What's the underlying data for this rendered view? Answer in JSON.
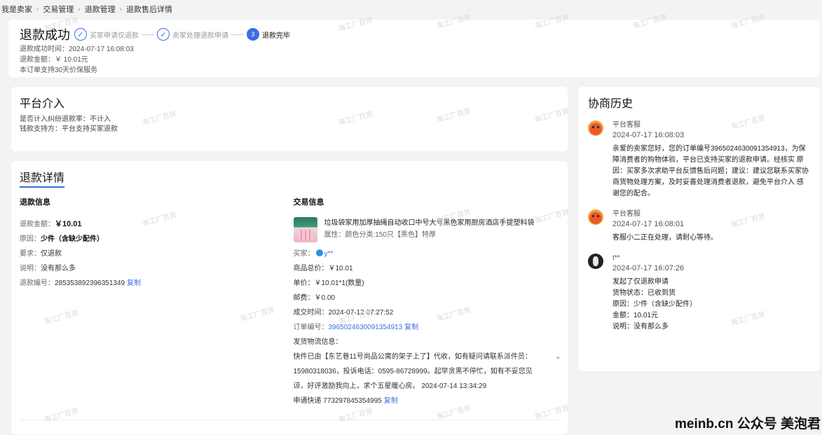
{
  "breadcrumb": [
    "我是卖家",
    "交易管理",
    "退款管理",
    "退款售后详情"
  ],
  "status": {
    "title": "退款成功",
    "steps": [
      {
        "label": "买家申请仅退款",
        "marker": "✓"
      },
      {
        "label": "卖家处理退款申请",
        "marker": "✓"
      },
      {
        "label": "退款完毕",
        "marker": "3"
      }
    ],
    "success_time": "退款成功时间：2024-07-17 16:08:03",
    "amount": "退款金额：￥ 10.01元",
    "guarantee": "本订单支持30天价保服务"
  },
  "platform": {
    "title": "平台介入",
    "dispute_rate": "是否计入纠纷退款率：不计入",
    "payment_support": "钱款支持方：平台支持买家退款"
  },
  "refund_detail": {
    "title": "退款详情",
    "refund_info": {
      "title": "退款信息",
      "amount_key": "退款金额：",
      "amount_value": "￥10.01",
      "reason_key": "原因：",
      "reason_value": "少件（含缺少配件）",
      "request_key": "要求：",
      "request_value": "仅退款",
      "note_key": "说明：",
      "note_value": "没有那么多",
      "number_key": "退款编号：",
      "number_value": "285353892396351349",
      "copy": "复制"
    },
    "trade_info": {
      "title": "交易信息",
      "product_name": "垃圾袋家用加厚抽绳自动收口中号大号黑色家用厨房酒店手提塑料袋",
      "product_attr": "属性：颜色分类:150只【黑色】特厚",
      "buyer_key": "买家：",
      "buyer_value": "y**",
      "total_price": "商品总价：￥10.01",
      "unit_price": "单价：￥10.01*1(数量)",
      "postage": "邮费：￥0.00",
      "trade_time": "成交时间：2024-07-12 07:27:52",
      "order_key": "订单编号：",
      "order_value": "3965024630091354913",
      "copy": "复制",
      "logistics_label": "发货物流信息：",
      "logistics_text": "快件已由【东艺巷11号尚品公寓的架子上了】代收，如有疑问请联系派件员：15980318036，投诉电话：0595-86728999。起早贪黑不停忙，如有不妥您见谅，好评激励我向上，求个五星暖心房。 2024-07-14 13:34:29",
      "tracking": "申通快递 773297845354995",
      "copy2": "复制"
    }
  },
  "history": {
    "title": "协商历史",
    "items": [
      {
        "name": "平台客服",
        "time": "2024-07-17 16:08:03",
        "content": "亲爱的卖家您好，您的订单编号3965024630091354913，为保障消费者的购物体验，平台已支持买家的退款申请。经核实 原因：买家多次求助平台反馈售后问题；建议：建议您联系买家协商货物处理方案，及时妥善处理消费者退款，避免平台介入  感谢您的配合。"
      },
      {
        "name": "平台客服",
        "time": "2024-07-17 16:08:01",
        "content": "客服小二正在处理，请耐心等待。"
      },
      {
        "name": "t**",
        "time": "2024-07-17 16:07:26",
        "lines": [
          "发起了仅退款申请",
          "货物状态：已收到货",
          "原因：少件（含缺少配件）",
          "金额：10.01元",
          "说明：没有那么多"
        ]
      }
    ]
  },
  "watermark_text": "淘工厂百货",
  "footer_watermark": "meinb.cn 公众号 美泡君"
}
